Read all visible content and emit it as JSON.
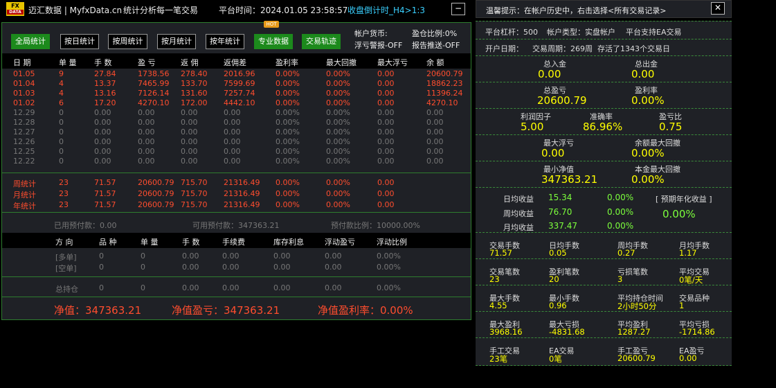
{
  "title": {
    "logo_top": "FX",
    "logo_bottom": "DATA",
    "brand": "迈汇数据 | MyfxData.cn",
    "slogan": "统计分析每一笔交易",
    "platform_time": "平台时间：2024.01.05 23:58:57",
    "countdown": "收盘倒计时_H4>1:3",
    "minimize": "−"
  },
  "toolbar": {
    "buttons": [
      "全局统计",
      "按日统计",
      "按周统计",
      "按月统计",
      "按年统计",
      "专业数据",
      "交易轨迹"
    ],
    "hot": "HOT",
    "currency": "帐户货币:",
    "ratio": "盈仓比例:0%",
    "float_alert": "浮亏警报-OFF",
    "report_push": "报告推送-OFF"
  },
  "table": {
    "headers": [
      "日 期",
      "单 量",
      "手 数",
      "盈 亏",
      "返 佣",
      "返佣差",
      "盈利率",
      "最大回撤",
      "最大浮亏",
      "余 额"
    ],
    "rows": [
      [
        "01.05",
        "9",
        "27.84",
        "1738.56",
        "278.40",
        "2016.96",
        "0.00%",
        "0.00%",
        "0.00",
        "20600.79"
      ],
      [
        "01.04",
        "4",
        "13.37",
        "7465.99",
        "133.70",
        "7599.69",
        "0.00%",
        "0.00%",
        "0.00",
        "18862.23"
      ],
      [
        "01.03",
        "4",
        "13.16",
        "7126.14",
        "131.60",
        "7257.74",
        "0.00%",
        "0.00%",
        "0.00",
        "11396.24"
      ],
      [
        "01.02",
        "6",
        "17.20",
        "4270.10",
        "172.00",
        "4442.10",
        "0.00%",
        "0.00%",
        "0.00",
        "4270.10"
      ],
      [
        "12.29",
        "0",
        "0.00",
        "0.00",
        "0.00",
        "0.00",
        "0.00%",
        "0.00%",
        "0.00",
        "0.00"
      ],
      [
        "12.28",
        "0",
        "0.00",
        "0.00",
        "0.00",
        "0.00",
        "0.00%",
        "0.00%",
        "0.00",
        "0.00"
      ],
      [
        "12.27",
        "0",
        "0.00",
        "0.00",
        "0.00",
        "0.00",
        "0.00%",
        "0.00%",
        "0.00",
        "0.00"
      ],
      [
        "12.26",
        "0",
        "0.00",
        "0.00",
        "0.00",
        "0.00",
        "0.00%",
        "0.00%",
        "0.00",
        "0.00"
      ],
      [
        "12.25",
        "0",
        "0.00",
        "0.00",
        "0.00",
        "0.00",
        "0.00%",
        "0.00%",
        "0.00",
        "0.00"
      ],
      [
        "12.22",
        "0",
        "0.00",
        "0.00",
        "0.00",
        "0.00",
        "0.00%",
        "0.00%",
        "0.00",
        "0.00"
      ]
    ],
    "summary": [
      [
        "周统计",
        "23",
        "71.57",
        "20600.79",
        "715.70",
        "21316.49",
        "0.00%",
        "0.00%",
        "0.00"
      ],
      [
        "月统计",
        "23",
        "71.57",
        "20600.79",
        "715.70",
        "21316.49",
        "0.00%",
        "0.00%",
        "0.00"
      ],
      [
        "年统计",
        "23",
        "71.57",
        "20600.79",
        "715.70",
        "21316.49",
        "0.00%",
        "0.00%",
        "0.00"
      ]
    ]
  },
  "margin": {
    "used": "已用预付款：0.00",
    "available": "可用预付款：347363.21",
    "ratio": "预付款比例：10000.00%"
  },
  "positions": {
    "headers": [
      "方 向",
      "品 种",
      "单 量",
      "手 数",
      "手续费",
      "库存利息",
      "浮动盈亏",
      "浮动比例"
    ],
    "rows": [
      [
        "[多单]",
        "0",
        "0",
        "0.00",
        "0.00",
        "0.00",
        "0.00",
        "0.00%"
      ],
      [
        "[空单]",
        "0",
        "0",
        "0.00",
        "0.00",
        "0.00",
        "0.00",
        "0.00%"
      ]
    ],
    "total": [
      "总持仓",
      "0",
      "0",
      "0.00",
      "0.00",
      "0.00",
      "0.00",
      "0.00%"
    ]
  },
  "equity": {
    "value": "净值：347363.21",
    "pnl": "净值盈亏：347363.21",
    "rate": "净值盈利率：0.00%"
  },
  "right": {
    "tip": "温馨提示：在帐户历史中，右击选择<所有交易记录>",
    "close": "✕",
    "leverage": "平台杠杆：500",
    "acct_type": "帐户类型：实盘帐户",
    "ea": "平台支持EA交易",
    "open_date": "开户日期：",
    "period": "交易周期：269周",
    "alive": "存活了1343个交易日",
    "deposit_l": "总入金",
    "deposit_v": "0.00",
    "withdraw_l": "总出金",
    "withdraw_v": "0.00",
    "pnl_l": "总盈亏",
    "pnl_v": "20600.79",
    "profit_rate_l": "盈利率",
    "profit_rate_v": "0.00%",
    "pf_l": "利润因子",
    "pf_v": "5.00",
    "acc_l": "准确率",
    "acc_v": "86.96%",
    "wl_l": "盈亏比",
    "wl_v": "0.75",
    "maxfloat_l": "最大浮亏",
    "maxfloat_v": "0.00",
    "maxdd_l": "余额最大回撤",
    "maxdd_v": "0.00%",
    "mineq_l": "最小净值",
    "mineq_v": "347363.21",
    "capdd_l": "本金最大回撤",
    "capdd_v": "0.00%",
    "daily_l": "日均收益",
    "daily_v": "15.34",
    "daily_p": "0.00%",
    "weekly_l": "周均收益",
    "weekly_v": "76.70",
    "weekly_p": "0.00%",
    "monthly_l": "月均收益",
    "monthly_v": "337.47",
    "monthly_p": "0.00%",
    "annual_l": "[ 预期年化收益 ]",
    "annual_v": "0.00%",
    "grid": [
      [
        "交易手数",
        "71.57",
        "日均手数",
        "0.05",
        "周均手数",
        "0.27",
        "月均手数",
        "1.17"
      ],
      [
        "交易笔数",
        "23",
        "盈利笔数",
        "20",
        "亏损笔数",
        "3",
        "平均交易",
        "0笔/天"
      ],
      [
        "最大手数",
        "4.55",
        "最小手数",
        "0.96",
        "平均持仓时间",
        "2小时50分",
        "交易品种",
        "1"
      ],
      [
        "最大盈利",
        "3968.16",
        "最大亏损",
        "-4831.68",
        "平均盈利",
        "1287.27",
        "平均亏损",
        "-1714.86"
      ],
      [
        "手工交易",
        "23笔",
        "EA交易",
        "0笔",
        "手工盈亏",
        "20600.79",
        "EA盈亏",
        "0.00"
      ]
    ]
  }
}
